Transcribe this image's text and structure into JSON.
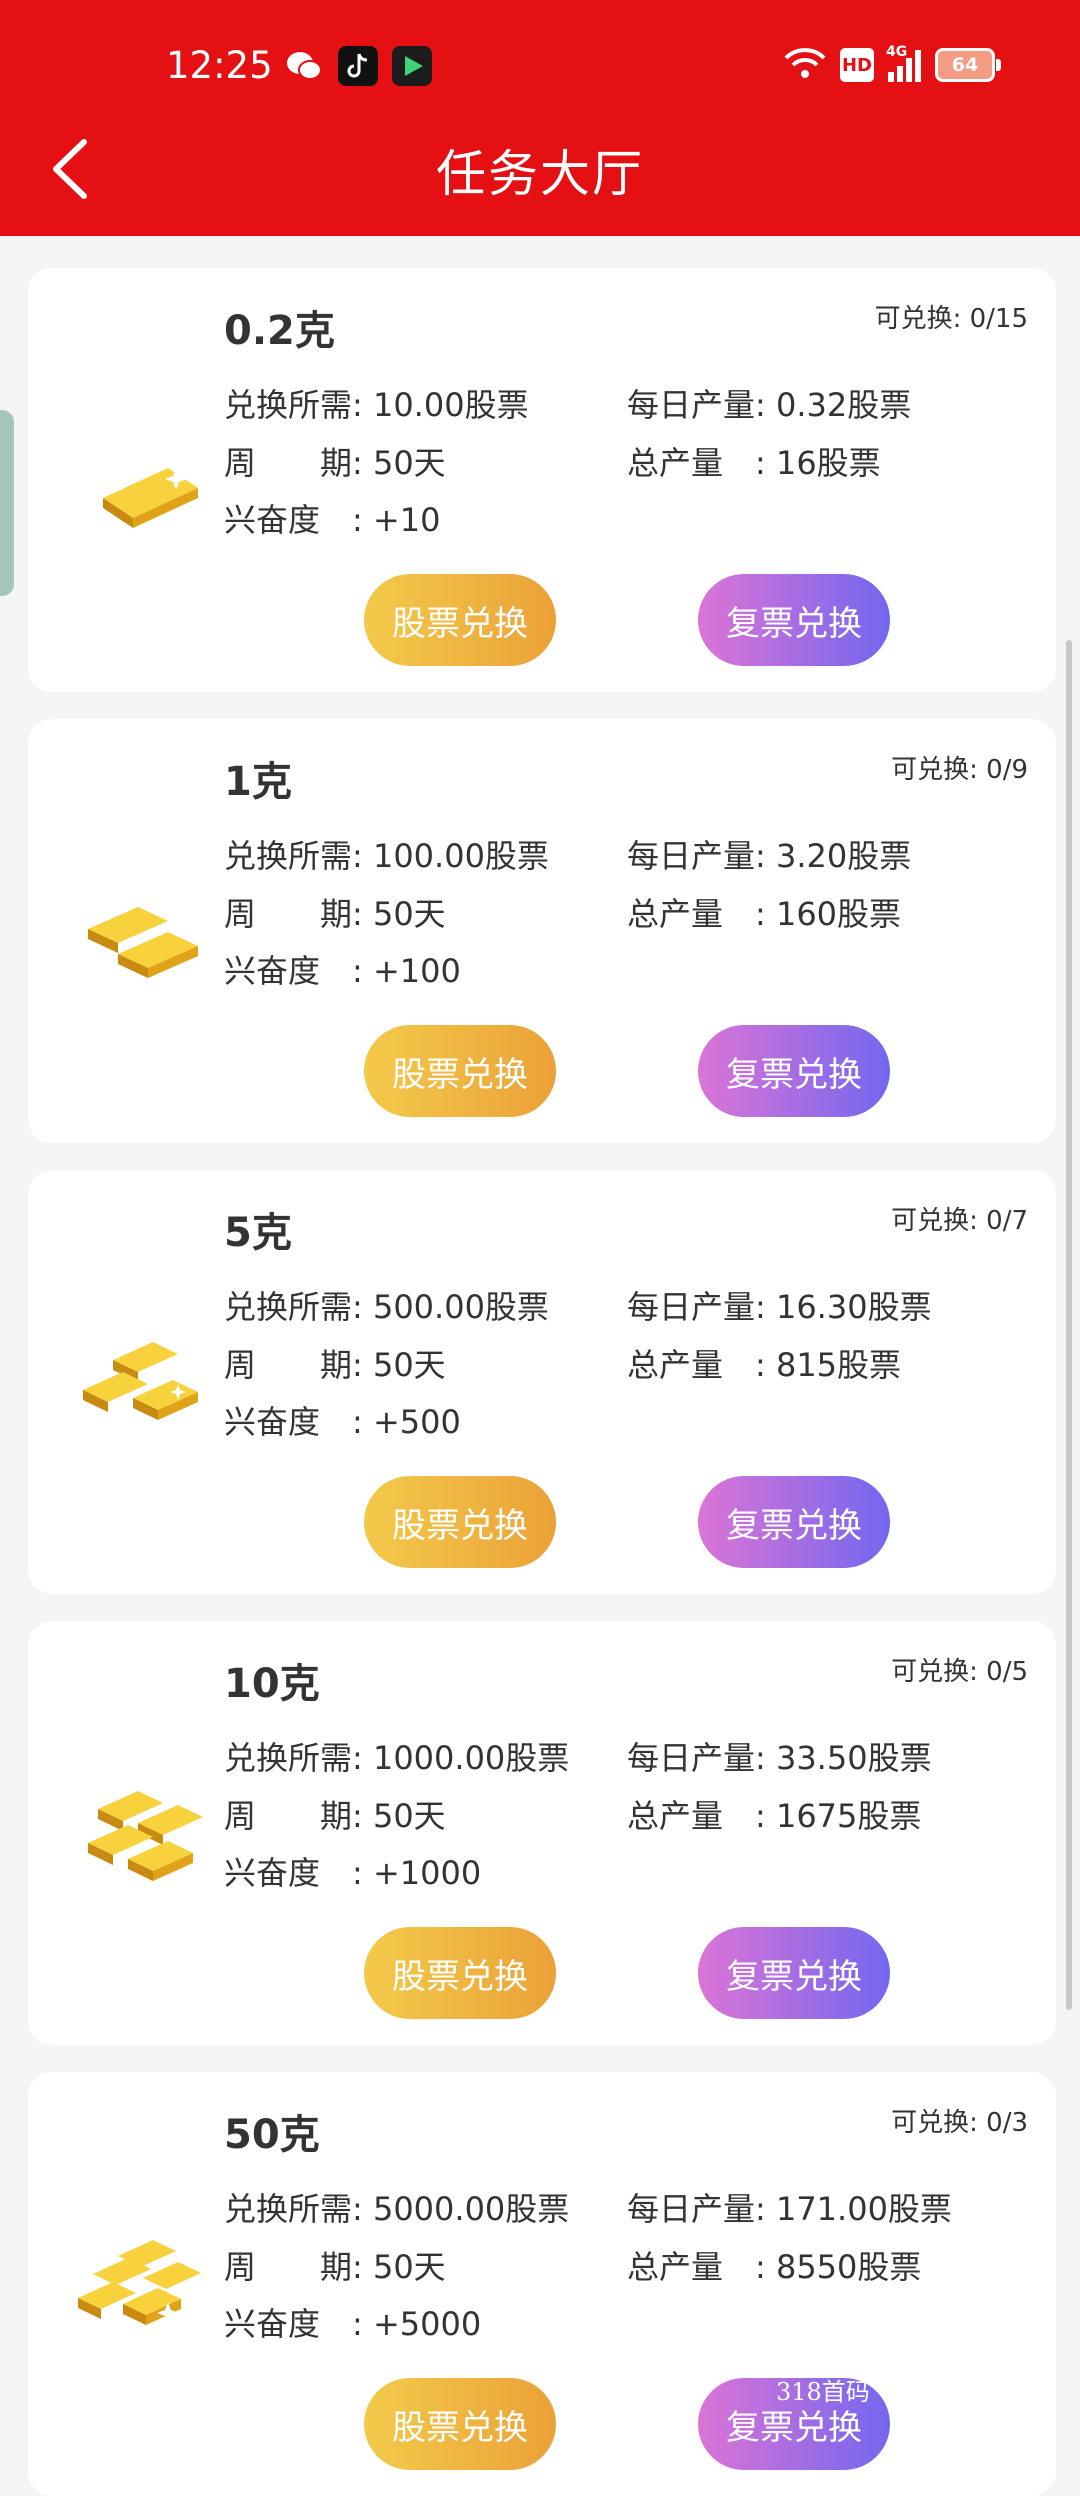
{
  "status": {
    "time": "12:25",
    "hd": "HD",
    "network": "4G",
    "battery": "64"
  },
  "header": {
    "title": "任务大厅"
  },
  "items": [
    {
      "title": "0.2克",
      "available": "可兑换: 0/15",
      "required": "兑换所需: 10.00股票",
      "daily": "每日产量: 0.32股票",
      "period": "周　　期: 50天",
      "total": "总产量　: 16股票",
      "excitement": "兴奋度　: +10",
      "btn_stock": "股票兑换",
      "btn_rebuy": "复票兑换"
    },
    {
      "title": "1克",
      "available": "可兑换: 0/9",
      "required": "兑换所需: 100.00股票",
      "daily": "每日产量: 3.20股票",
      "period": "周　　期: 50天",
      "total": "总产量　: 160股票",
      "excitement": "兴奋度　: +100",
      "btn_stock": "股票兑换",
      "btn_rebuy": "复票兑换"
    },
    {
      "title": "5克",
      "available": "可兑换: 0/7",
      "required": "兑换所需: 500.00股票",
      "daily": "每日产量: 16.30股票",
      "period": "周　　期: 50天",
      "total": "总产量　: 815股票",
      "excitement": "兴奋度　: +500",
      "btn_stock": "股票兑换",
      "btn_rebuy": "复票兑换"
    },
    {
      "title": "10克",
      "available": "可兑换: 0/5",
      "required": "兑换所需: 1000.00股票",
      "daily": "每日产量: 33.50股票",
      "period": "周　　期: 50天",
      "total": "总产量　: 1675股票",
      "excitement": "兴奋度　: +1000",
      "btn_stock": "股票兑换",
      "btn_rebuy": "复票兑换"
    },
    {
      "title": "50克",
      "available": "可兑换: 0/3",
      "required": "兑换所需: 5000.00股票",
      "daily": "每日产量: 171.00股票",
      "period": "周　　期: 50天",
      "total": "总产量　: 8550股票",
      "excitement": "兴奋度　: +5000",
      "btn_stock": "股票兑换",
      "btn_rebuy": "复票兑换"
    }
  ],
  "watermark": "318首码"
}
